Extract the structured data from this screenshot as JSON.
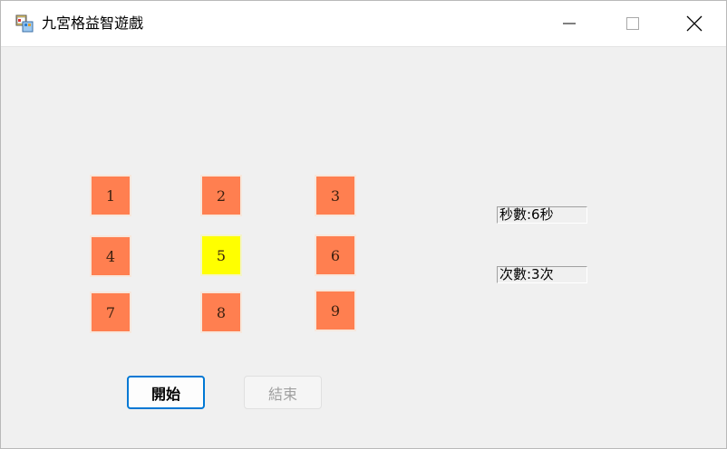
{
  "window": {
    "title": "九宮格益智遊戲"
  },
  "caption_buttons": {
    "minimize_icon": "minimize-icon",
    "maximize_icon": "maximize-icon",
    "close_icon": "close-icon"
  },
  "grid": {
    "tiles": [
      {
        "label": "1",
        "highlighted": false
      },
      {
        "label": "2",
        "highlighted": false
      },
      {
        "label": "3",
        "highlighted": false
      },
      {
        "label": "4",
        "highlighted": false
      },
      {
        "label": "5",
        "highlighted": true
      },
      {
        "label": "6",
        "highlighted": false
      },
      {
        "label": "7",
        "highlighted": false
      },
      {
        "label": "8",
        "highlighted": false
      },
      {
        "label": "9",
        "highlighted": false
      }
    ],
    "tile_color": "#ff7f50",
    "highlight_color": "#ffff00"
  },
  "stats": {
    "seconds": "秒數:6秒",
    "count": "次數:3次"
  },
  "buttons": {
    "start_label": "開始",
    "end_label": "結束"
  }
}
